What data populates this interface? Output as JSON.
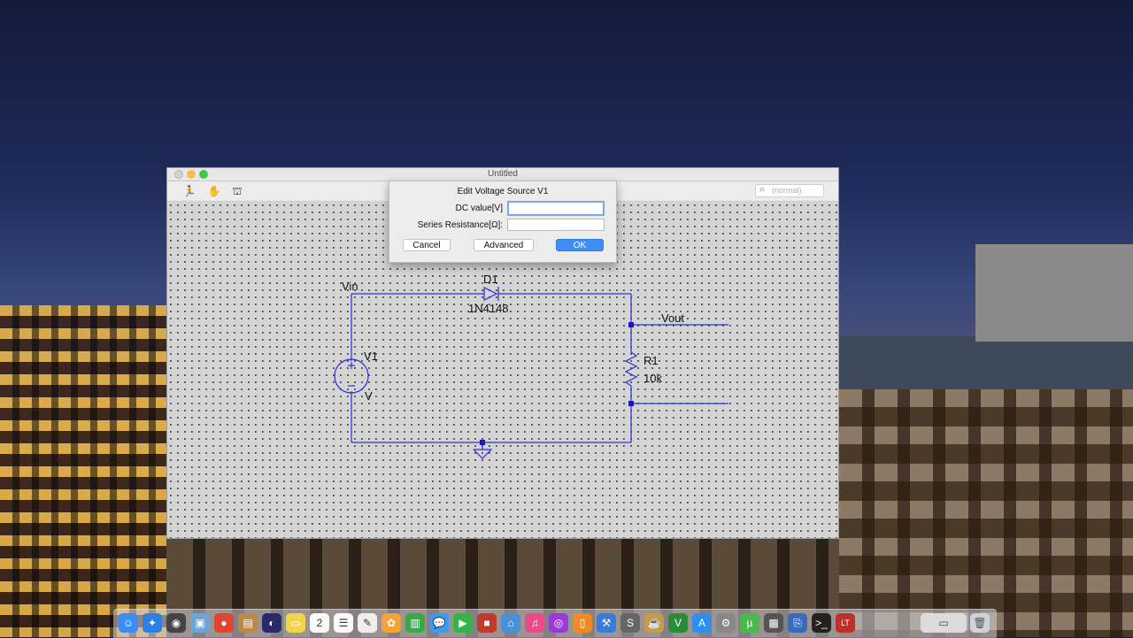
{
  "window": {
    "title": "Untitled",
    "search_placeholder": "(normal)"
  },
  "toolbar": {
    "icons": [
      "run-icon",
      "hand-icon",
      "halt-icon"
    ]
  },
  "schematic": {
    "net_vin": "Vin",
    "net_vout": "Vout",
    "diode_ref": "D1",
    "diode_value": "1N4148",
    "source_ref": "V1",
    "source_value": "V",
    "resistor_ref": "R1",
    "resistor_value": "10k"
  },
  "dialog": {
    "title": "Edit Voltage Source V1",
    "dc_label": "DC value[V]",
    "dc_value": "",
    "series_label": "Series Resistance[Ω]:",
    "series_value": "",
    "cancel_label": "Cancel",
    "advanced_label": "Advanced",
    "ok_label": "OK"
  },
  "dock": {
    "apps": [
      "finder-icon",
      "safari-icon",
      "launchpad-icon",
      "preview-icon",
      "chrome-icon",
      "contacts-icon",
      "eclipse-icon",
      "notes-icon",
      "calendar-icon",
      "reminders-icon",
      "textedit-icon",
      "photos-icon",
      "numbers-icon",
      "messages-icon",
      "facetime-icon",
      "photobooth-icon",
      "keynote-icon",
      "itunes-icon",
      "podcast-icon",
      "ibooks-icon",
      "xcode-icon",
      "script-icon",
      "cup-icon",
      "vim-icon",
      "appstore-icon",
      "prefs-icon",
      "torrent-icon",
      "image-icon",
      "kvm-icon",
      "terminal-icon",
      "ltspice-icon",
      "folder-icon",
      "trash-icon"
    ]
  }
}
